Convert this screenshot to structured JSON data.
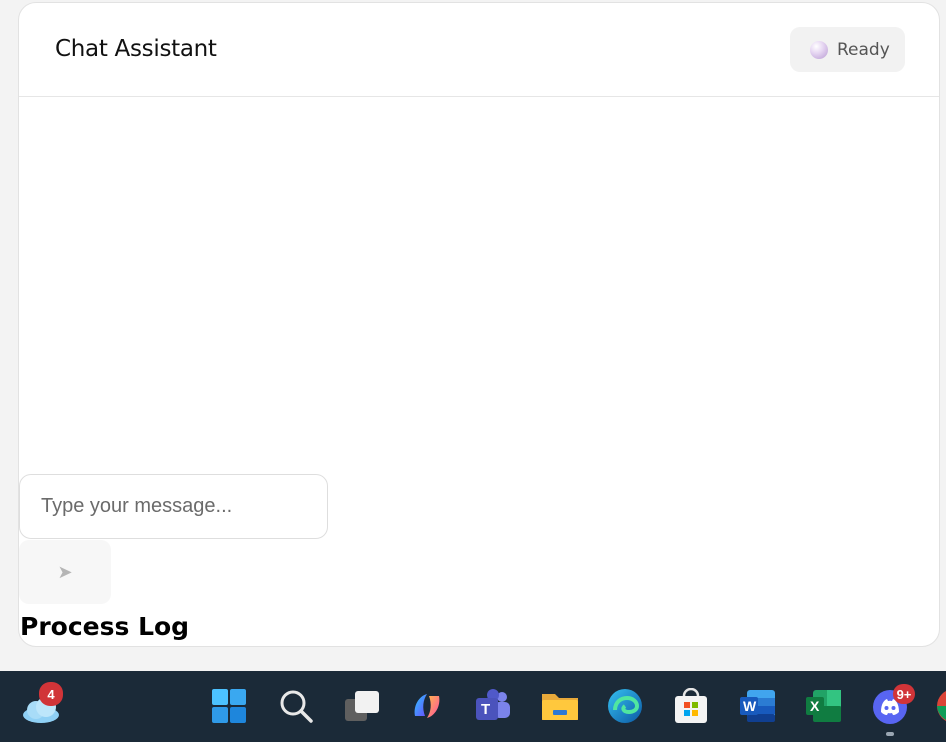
{
  "chat": {
    "title": "Chat Assistant",
    "status": "Ready",
    "input_placeholder": "Type your message...",
    "send_icon": "➤",
    "process_log_title": "Process Log"
  },
  "taskbar": {
    "weather_badge": "4",
    "discord_badge": "9+",
    "word_letter": "W",
    "excel_letter": "X",
    "teams_letter": "T"
  },
  "colors": {
    "taskbar_bg": "#1b2a38",
    "badge_red": "#d13438",
    "status_pill_bg": "#f2f2f2"
  }
}
